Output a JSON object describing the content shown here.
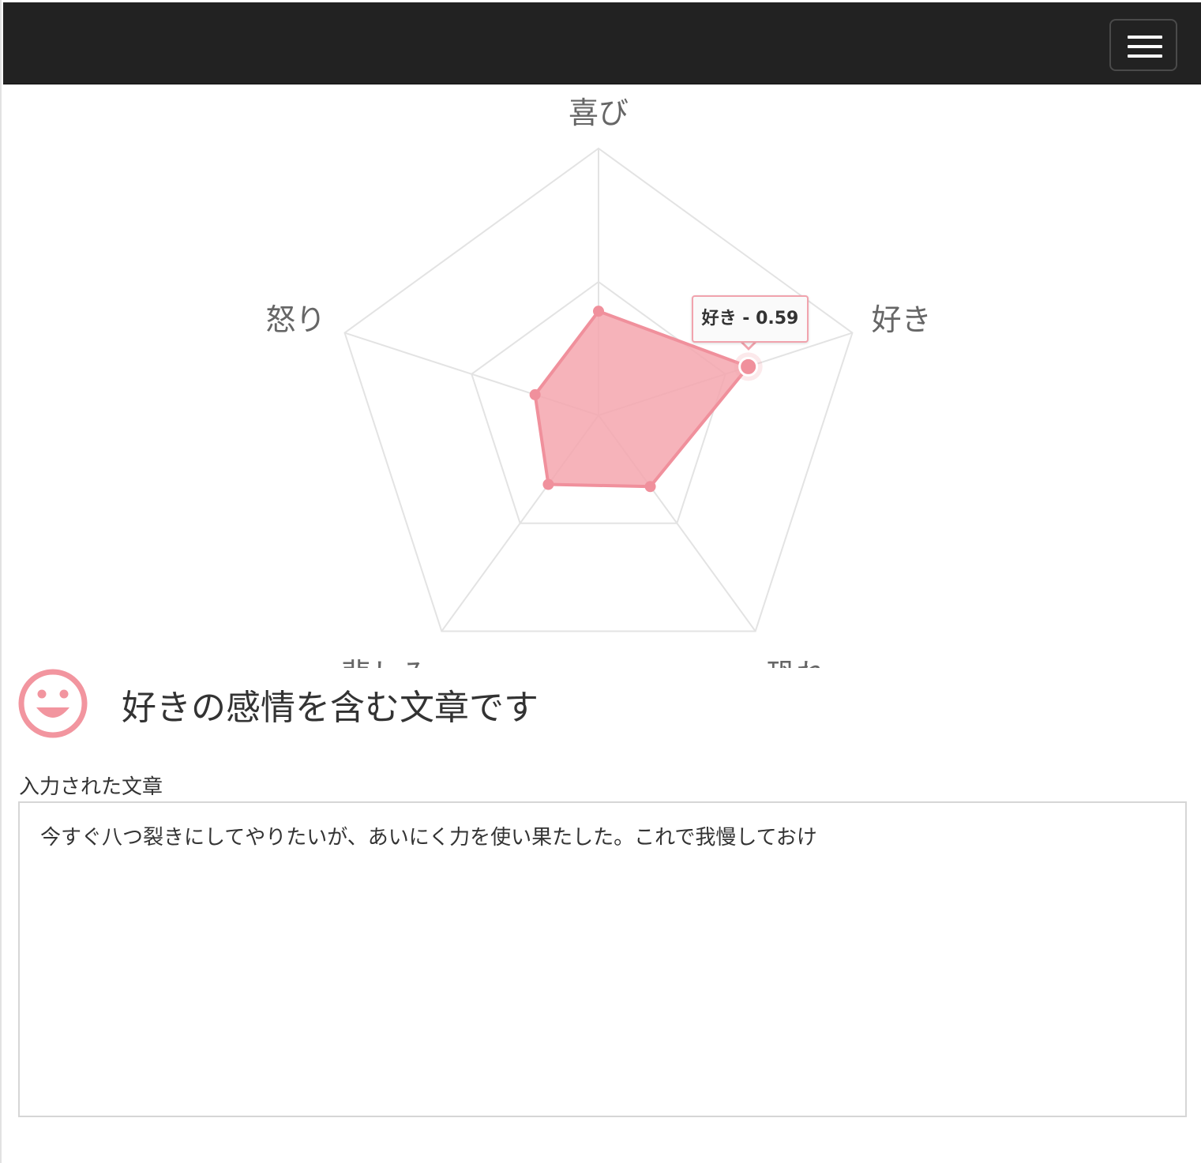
{
  "navbar": {
    "menu_icon": "hamburger-menu-icon"
  },
  "chart_data": {
    "type": "radar",
    "labels": [
      "喜び",
      "好き",
      "恐れ",
      "悲しみ",
      "怒り"
    ],
    "values": [
      0.39,
      0.59,
      0.33,
      0.32,
      0.25
    ],
    "rmax": 1.0,
    "grid": true,
    "fill_color": "#f4a6ae",
    "line_color": "#f0909c",
    "tooltip": {
      "label": "好き",
      "value": 0.59,
      "text": "好き - 0.59"
    }
  },
  "result": {
    "icon": "smiley-face-icon",
    "icon_color": "#f2959f",
    "title": "好きの感情を含む文章です"
  },
  "input": {
    "label": "入力された文章",
    "text": "今すぐ八つ裂きにしてやりたいが、あいにく力を使い果たした。これで我慢しておけ"
  }
}
